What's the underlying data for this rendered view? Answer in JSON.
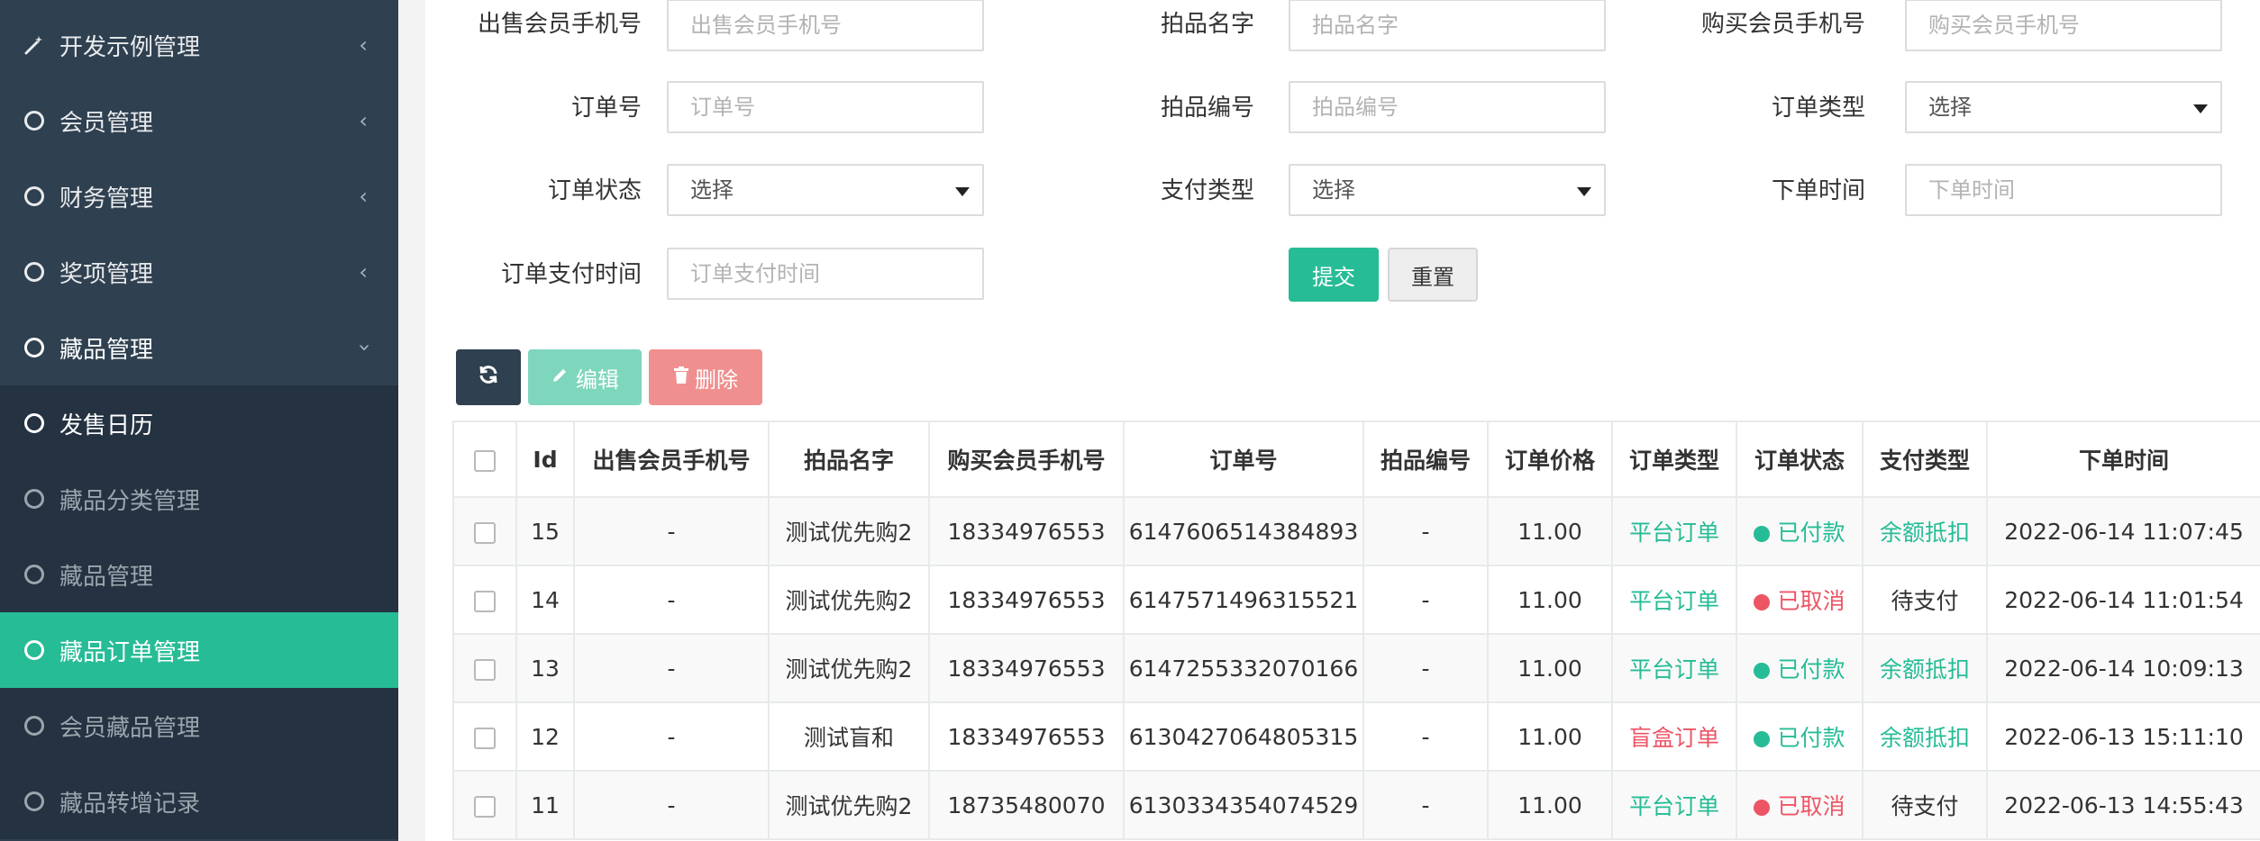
{
  "sidebar": {
    "items": [
      {
        "label": "开发示例管理",
        "icon": "wand-icon"
      },
      {
        "label": "会员管理",
        "icon": "circle-icon"
      },
      {
        "label": "财务管理",
        "icon": "circle-icon"
      },
      {
        "label": "奖项管理",
        "icon": "circle-icon"
      },
      {
        "label": "藏品管理",
        "icon": "circle-icon"
      },
      {
        "label": "发售日历",
        "icon": "circle-icon"
      },
      {
        "label": "藏品分类管理",
        "icon": "circle-icon"
      },
      {
        "label": "藏品管理",
        "icon": "circle-icon"
      },
      {
        "label": "藏品订单管理",
        "icon": "circle-icon"
      },
      {
        "label": "会员藏品管理",
        "icon": "circle-icon"
      },
      {
        "label": "藏品转增记录",
        "icon": "circle-icon"
      }
    ],
    "active": "藏品订单管理"
  },
  "filters": {
    "seller_phone": {
      "label": "出售会员手机号",
      "placeholder": "出售会员手机号"
    },
    "item_name": {
      "label": "拍品名字",
      "placeholder": "拍品名字"
    },
    "buyer_phone": {
      "label": "购买会员手机号",
      "placeholder": "购买会员手机号"
    },
    "order_no": {
      "label": "订单号",
      "placeholder": "订单号"
    },
    "item_no": {
      "label": "拍品编号",
      "placeholder": "拍品编号"
    },
    "order_type": {
      "label": "订单类型",
      "value": "选择"
    },
    "order_status": {
      "label": "订单状态",
      "value": "选择"
    },
    "pay_type": {
      "label": "支付类型",
      "value": "选择"
    },
    "order_time": {
      "label": "下单时间",
      "placeholder": "下单时间"
    },
    "pay_time": {
      "label": "订单支付时间",
      "placeholder": "订单支付时间"
    },
    "submit_label": "提交",
    "reset_label": "重置"
  },
  "toolbar": {
    "refresh_icon": "refresh-icon",
    "edit_label": "编辑",
    "delete_label": "删除"
  },
  "table": {
    "headers": [
      "Id",
      "出售会员手机号",
      "拍品名字",
      "购买会员手机号",
      "订单号",
      "拍品编号",
      "订单价格",
      "订单类型",
      "订单状态",
      "支付类型",
      "下单时间"
    ],
    "rows": [
      {
        "id": "15",
        "seller": "-",
        "item": "测试优先购2",
        "buyer": "18334976553",
        "order_no": "6147606514384893",
        "item_no": "-",
        "price": "11.00",
        "type": "平台订单",
        "status": "已付款",
        "pay": "余额抵扣",
        "time": "2022-06-14 11:07:45"
      },
      {
        "id": "14",
        "seller": "-",
        "item": "测试优先购2",
        "buyer": "18334976553",
        "order_no": "6147571496315521",
        "item_no": "-",
        "price": "11.00",
        "type": "平台订单",
        "status": "已取消",
        "pay": "待支付",
        "time": "2022-06-14 11:01:54"
      },
      {
        "id": "13",
        "seller": "-",
        "item": "测试优先购2",
        "buyer": "18334976553",
        "order_no": "6147255332070166",
        "item_no": "-",
        "price": "11.00",
        "type": "平台订单",
        "status": "已付款",
        "pay": "余额抵扣",
        "time": "2022-06-14 10:09:13"
      },
      {
        "id": "12",
        "seller": "-",
        "item": "测试盲和",
        "buyer": "18334976553",
        "order_no": "6130427064805315",
        "item_no": "-",
        "price": "11.00",
        "type": "盲盒订单",
        "status": "已付款",
        "pay": "余额抵扣",
        "time": "2022-06-13 15:11:10"
      },
      {
        "id": "11",
        "seller": "-",
        "item": "测试优先购2",
        "buyer": "18735480070",
        "order_no": "6130334354074529",
        "item_no": "-",
        "price": "11.00",
        "type": "平台订单",
        "status": "已取消",
        "pay": "待支付",
        "time": "2022-06-13 14:55:43"
      }
    ]
  },
  "colors": {
    "accent": "#26bc96",
    "danger": "#ed5565",
    "sidebar": "#2f4050"
  }
}
